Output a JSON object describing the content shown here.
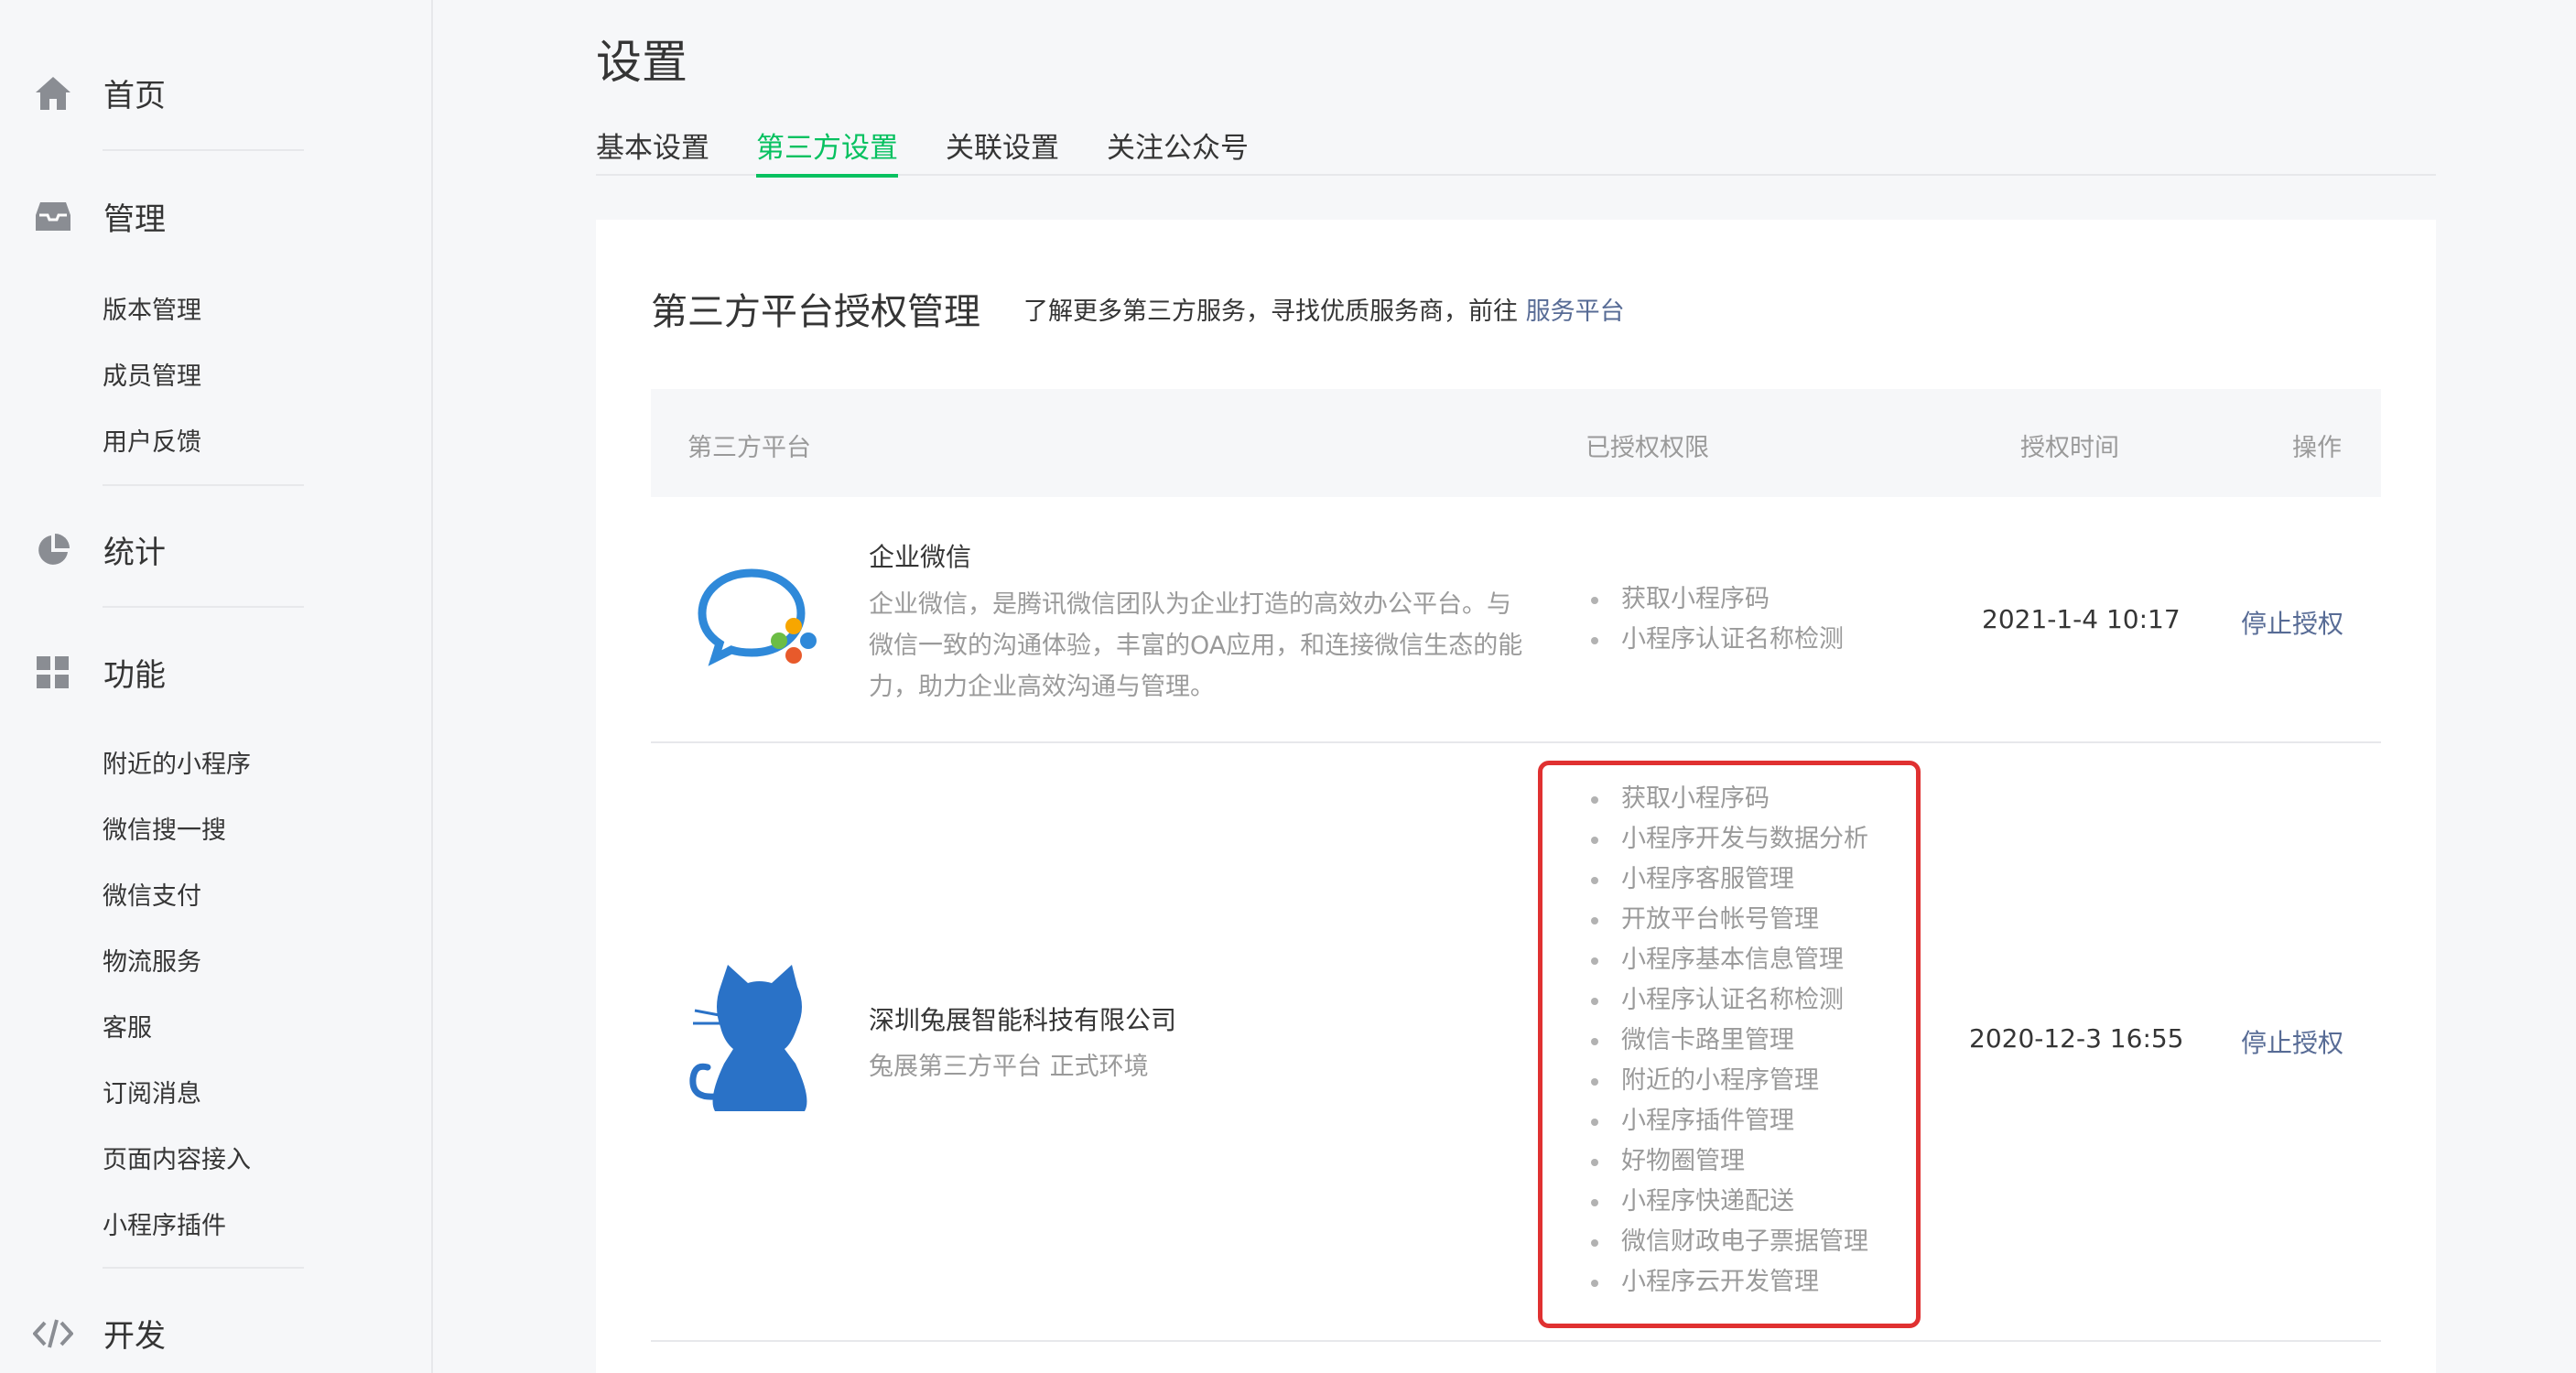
{
  "sidebar": {
    "home": {
      "label": "首页",
      "icon": "home-icon"
    },
    "manage": {
      "label": "管理",
      "icon": "inbox-icon",
      "items": [
        {
          "label": "版本管理"
        },
        {
          "label": "成员管理"
        },
        {
          "label": "用户反馈"
        }
      ]
    },
    "stats": {
      "label": "统计",
      "icon": "pie-chart-icon"
    },
    "features": {
      "label": "功能",
      "icon": "grid-icon",
      "items": [
        {
          "label": "附近的小程序"
        },
        {
          "label": "微信搜一搜"
        },
        {
          "label": "微信支付"
        },
        {
          "label": "物流服务"
        },
        {
          "label": "客服"
        },
        {
          "label": "订阅消息"
        },
        {
          "label": "页面内容接入"
        },
        {
          "label": "小程序插件"
        }
      ]
    },
    "dev": {
      "label": "开发",
      "icon": "code-icon"
    }
  },
  "page": {
    "title": "设置",
    "tabs": [
      {
        "label": "基本设置"
      },
      {
        "label": "第三方设置"
      },
      {
        "label": "关联设置"
      },
      {
        "label": "关注公众号"
      }
    ],
    "active_tab": "第三方设置"
  },
  "card": {
    "title": "第三方平台授权管理",
    "desc": "了解更多第三方服务，寻找优质服务商，前往 ",
    "link": "服务平台"
  },
  "table": {
    "headers": {
      "platform": "第三方平台",
      "perms": "已授权权限",
      "time": "授权时间",
      "op": "操作"
    },
    "rows": [
      {
        "name": "企业微信",
        "desc_lines": [
          "企业微信，是腾讯微信团队为企业打造的高效办公平台。与",
          "微信一致的沟通体验，丰富的OA应用，和连接微信生态的能",
          "力，助力企业高效沟通与管理。"
        ],
        "logo": "wework-logo-icon",
        "perms": [
          "获取小程序码",
          "小程序认证名称检测"
        ],
        "time": "2021-1-4 10:17",
        "op": "停止授权"
      },
      {
        "name": "深圳兔展智能科技有限公司",
        "desc_lines": [
          "兔展第三方平台 正式环境"
        ],
        "logo": "cat-logo-icon",
        "perms": [
          "获取小程序码",
          "小程序开发与数据分析",
          "小程序客服管理",
          "开放平台帐号管理",
          "小程序基本信息管理",
          "小程序认证名称检测",
          "微信卡路里管理",
          "附近的小程序管理",
          "小程序插件管理",
          "好物圈管理",
          "小程序快递配送",
          "微信财政电子票据管理",
          "小程序云开发管理"
        ],
        "time": "2020-12-3 16:55",
        "op": "停止授权"
      }
    ]
  },
  "colors": {
    "accent": "#07c160",
    "link": "#576b95",
    "muted": "#9a9a9a",
    "highlight": "#e03131"
  }
}
